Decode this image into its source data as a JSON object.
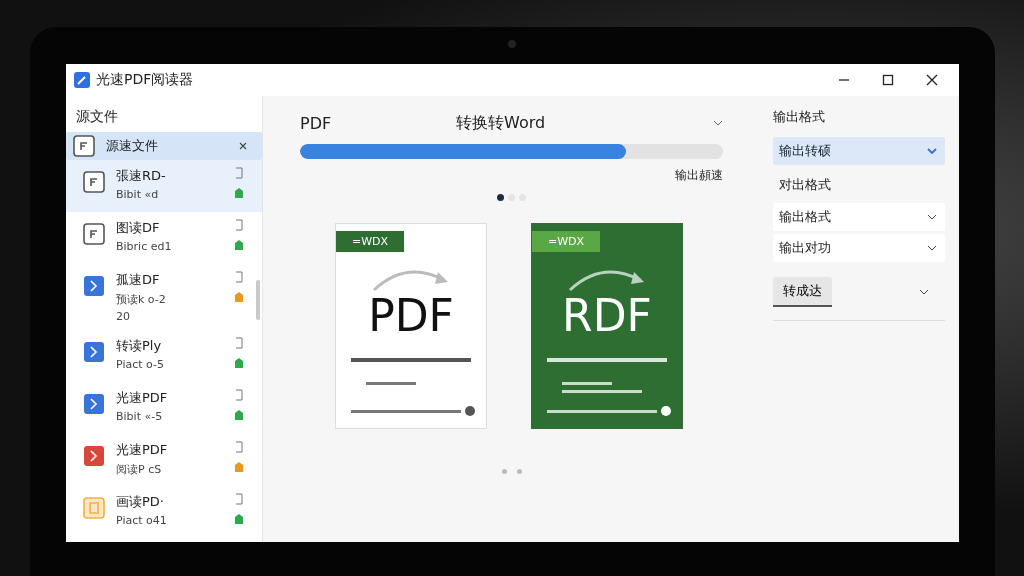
{
  "window": {
    "title": "光速PDF阅读器"
  },
  "sidebar": {
    "title": "源文件",
    "files": [
      {
        "name": "源速文件",
        "kind": "outline",
        "selected": true,
        "highlighted": true,
        "closable": true
      },
      {
        "name": "張速RD-",
        "subtitle": "Bibit «d",
        "kind": "outline",
        "warning": false,
        "selected": false,
        "highlighted": true,
        "closable": false
      },
      {
        "name": "图读DF",
        "subtitle": "Bibric ed1",
        "kind": "outline",
        "warning": false,
        "selected": false,
        "highlighted": false,
        "closable": false
      },
      {
        "name": "孤速DF",
        "subtitle": "预读k o-2",
        "extra": "20",
        "color": "#3b74d8",
        "kind": "filled",
        "warning": true,
        "selected": false,
        "highlighted": false,
        "closable": false
      },
      {
        "name": "转读Ply",
        "subtitle": "Piact o-5",
        "color": "#3b74d8",
        "kind": "filled",
        "warning": false,
        "selected": false,
        "highlighted": false,
        "closable": false
      },
      {
        "name": "光速PDF",
        "subtitle": "Bibit «-5",
        "color": "#3b74d8",
        "kind": "filled",
        "warning": false,
        "selected": false,
        "highlighted": false,
        "closable": false
      },
      {
        "name": "光速PDF",
        "subtitle": "阅读P cS",
        "color": "#d9473c",
        "kind": "filled",
        "warning": true,
        "selected": false,
        "highlighted": false,
        "closable": false
      },
      {
        "name": "画读PD·",
        "subtitle": "Piact o41",
        "kind": "light",
        "warning": false,
        "selected": false,
        "highlighted": false,
        "closable": false
      }
    ]
  },
  "conversion": {
    "source": "PDF",
    "target": "转换转Word",
    "progress": {
      "level": 0.77
    },
    "status": "输出頳速",
    "pager": [
      {
        "selected": true
      },
      {
        "selected": false
      },
      {
        "selected": false
      }
    ],
    "previews": [
      {
        "kind": "light",
        "tag": "=WDX",
        "heading": "PDF"
      },
      {
        "kind": "dark",
        "tag": "=WDX",
        "heading": "RDF"
      }
    ]
  },
  "settings": {
    "title": "输出格式",
    "selects": [
      {
        "kind": "select",
        "value": "输出转硕",
        "selected": true
      },
      {
        "kind": "label",
        "value": "对出格式"
      },
      {
        "kind": "select",
        "value": "输出格式",
        "selected": false
      },
      {
        "kind": "select",
        "value": "输出对功",
        "selected": false
      }
    ],
    "button": "转成达"
  }
}
